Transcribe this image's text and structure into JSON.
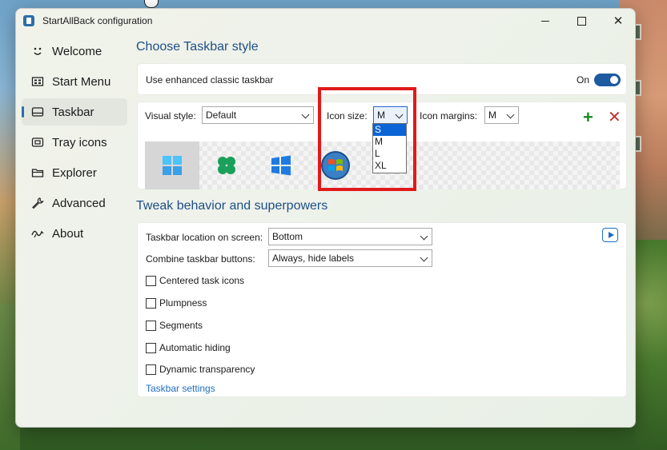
{
  "window": {
    "title": "StartAllBack configuration"
  },
  "sidebar": {
    "items": [
      {
        "label": "Welcome",
        "icon": "smile-icon"
      },
      {
        "label": "Start Menu",
        "icon": "start-menu-icon"
      },
      {
        "label": "Taskbar",
        "icon": "taskbar-icon"
      },
      {
        "label": "Tray icons",
        "icon": "tray-icon"
      },
      {
        "label": "Explorer",
        "icon": "folder-icon"
      },
      {
        "label": "Advanced",
        "icon": "wrench-icon"
      },
      {
        "label": "About",
        "icon": "about-icon"
      }
    ],
    "active": "Taskbar"
  },
  "taskbar_style": {
    "section_title": "Choose Taskbar style",
    "enhanced_label": "Use enhanced classic taskbar",
    "enhanced_state_label": "On",
    "enhanced_on": true,
    "visual_style_label": "Visual style:",
    "visual_style_value": "Default",
    "icon_size_label": "Icon size:",
    "icon_size_value": "M",
    "icon_size_options": [
      "S",
      "M",
      "L",
      "XL"
    ],
    "icon_size_highlighted": "S",
    "icon_margins_label": "Icon margins:",
    "icon_margins_value": "M"
  },
  "behavior": {
    "section_title": "Tweak behavior and superpowers",
    "location_label": "Taskbar location on screen:",
    "location_value": "Bottom",
    "combine_label": "Combine taskbar buttons:",
    "combine_value": "Always, hide labels",
    "checkboxes": [
      "Centered task icons",
      "Plumpness",
      "Segments",
      "Automatic hiding",
      "Dynamic transparency"
    ],
    "settings_link": "Taskbar settings"
  },
  "colors": {
    "accent": "#1e4f88",
    "toggle_on": "#1d5aa0",
    "annotation_red": "#e01a1a",
    "plus_green": "#1a8a28",
    "close_red": "#c03434"
  }
}
